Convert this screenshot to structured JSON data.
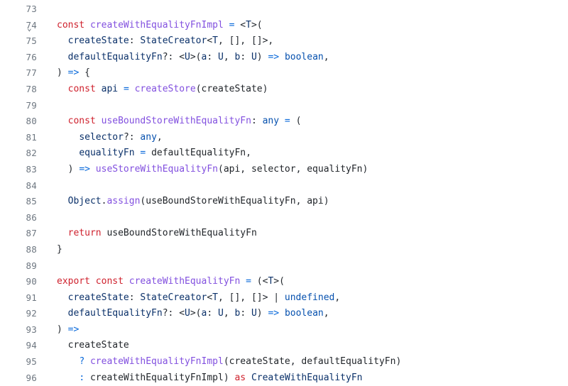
{
  "editor": {
    "lines": [
      {
        "num": "73",
        "fold": "",
        "tokens": []
      },
      {
        "num": "74",
        "fold": "v",
        "tokens": [
          {
            "c": "kw",
            "t": "const"
          },
          {
            "c": "plain",
            "t": " "
          },
          {
            "c": "def",
            "t": "createWithEqualityFnImpl"
          },
          {
            "c": "plain",
            "t": " "
          },
          {
            "c": "op",
            "t": "="
          },
          {
            "c": "plain",
            "t": " "
          },
          {
            "c": "punct",
            "t": "<"
          },
          {
            "c": "type",
            "t": "T"
          },
          {
            "c": "punct",
            "t": ">("
          }
        ]
      },
      {
        "num": "75",
        "fold": "",
        "tokens": [
          {
            "c": "plain",
            "t": "  "
          },
          {
            "c": "param",
            "t": "createState"
          },
          {
            "c": "punct",
            "t": ": "
          },
          {
            "c": "type",
            "t": "StateCreator"
          },
          {
            "c": "punct",
            "t": "<"
          },
          {
            "c": "type",
            "t": "T"
          },
          {
            "c": "punct",
            "t": ", [], []>,"
          }
        ]
      },
      {
        "num": "76",
        "fold": "",
        "tokens": [
          {
            "c": "plain",
            "t": "  "
          },
          {
            "c": "param",
            "t": "defaultEqualityFn"
          },
          {
            "c": "punct",
            "t": "?: <"
          },
          {
            "c": "type",
            "t": "U"
          },
          {
            "c": "punct",
            "t": ">("
          },
          {
            "c": "param",
            "t": "a"
          },
          {
            "c": "punct",
            "t": ": "
          },
          {
            "c": "type",
            "t": "U"
          },
          {
            "c": "punct",
            "t": ", "
          },
          {
            "c": "param",
            "t": "b"
          },
          {
            "c": "punct",
            "t": ": "
          },
          {
            "c": "type",
            "t": "U"
          },
          {
            "c": "punct",
            "t": ") "
          },
          {
            "c": "op",
            "t": "=>"
          },
          {
            "c": "plain",
            "t": " "
          },
          {
            "c": "builtin",
            "t": "boolean"
          },
          {
            "c": "punct",
            "t": ","
          }
        ]
      },
      {
        "num": "77",
        "fold": "",
        "tokens": [
          {
            "c": "punct",
            "t": ") "
          },
          {
            "c": "op",
            "t": "=>"
          },
          {
            "c": "plain",
            "t": " "
          },
          {
            "c": "punct",
            "t": "{"
          }
        ]
      },
      {
        "num": "78",
        "fold": "",
        "tokens": [
          {
            "c": "plain",
            "t": "  "
          },
          {
            "c": "kw",
            "t": "const"
          },
          {
            "c": "plain",
            "t": " "
          },
          {
            "c": "param",
            "t": "api"
          },
          {
            "c": "plain",
            "t": " "
          },
          {
            "c": "op",
            "t": "="
          },
          {
            "c": "plain",
            "t": " "
          },
          {
            "c": "fn",
            "t": "createStore"
          },
          {
            "c": "punct",
            "t": "("
          },
          {
            "c": "plain",
            "t": "createState"
          },
          {
            "c": "punct",
            "t": ")"
          }
        ]
      },
      {
        "num": "79",
        "fold": "",
        "tokens": []
      },
      {
        "num": "80",
        "fold": "",
        "tokens": [
          {
            "c": "plain",
            "t": "  "
          },
          {
            "c": "kw",
            "t": "const"
          },
          {
            "c": "plain",
            "t": " "
          },
          {
            "c": "def",
            "t": "useBoundStoreWithEqualityFn"
          },
          {
            "c": "punct",
            "t": ": "
          },
          {
            "c": "builtin",
            "t": "any"
          },
          {
            "c": "plain",
            "t": " "
          },
          {
            "c": "op",
            "t": "="
          },
          {
            "c": "plain",
            "t": " "
          },
          {
            "c": "punct",
            "t": "("
          }
        ]
      },
      {
        "num": "81",
        "fold": "",
        "tokens": [
          {
            "c": "plain",
            "t": "    "
          },
          {
            "c": "param",
            "t": "selector"
          },
          {
            "c": "punct",
            "t": "?: "
          },
          {
            "c": "builtin",
            "t": "any"
          },
          {
            "c": "punct",
            "t": ","
          }
        ]
      },
      {
        "num": "82",
        "fold": "",
        "tokens": [
          {
            "c": "plain",
            "t": "    "
          },
          {
            "c": "param",
            "t": "equalityFn"
          },
          {
            "c": "plain",
            "t": " "
          },
          {
            "c": "op",
            "t": "="
          },
          {
            "c": "plain",
            "t": " defaultEqualityFn"
          },
          {
            "c": "punct",
            "t": ","
          }
        ]
      },
      {
        "num": "83",
        "fold": "",
        "tokens": [
          {
            "c": "plain",
            "t": "  "
          },
          {
            "c": "punct",
            "t": ") "
          },
          {
            "c": "op",
            "t": "=>"
          },
          {
            "c": "plain",
            "t": " "
          },
          {
            "c": "fn",
            "t": "useStoreWithEqualityFn"
          },
          {
            "c": "punct",
            "t": "("
          },
          {
            "c": "plain",
            "t": "api"
          },
          {
            "c": "punct",
            "t": ", "
          },
          {
            "c": "plain",
            "t": "selector"
          },
          {
            "c": "punct",
            "t": ", "
          },
          {
            "c": "plain",
            "t": "equalityFn"
          },
          {
            "c": "punct",
            "t": ")"
          }
        ]
      },
      {
        "num": "84",
        "fold": "",
        "tokens": []
      },
      {
        "num": "85",
        "fold": "",
        "tokens": [
          {
            "c": "plain",
            "t": "  "
          },
          {
            "c": "type",
            "t": "Object"
          },
          {
            "c": "punct",
            "t": "."
          },
          {
            "c": "fn",
            "t": "assign"
          },
          {
            "c": "punct",
            "t": "("
          },
          {
            "c": "plain",
            "t": "useBoundStoreWithEqualityFn"
          },
          {
            "c": "punct",
            "t": ", "
          },
          {
            "c": "plain",
            "t": "api"
          },
          {
            "c": "punct",
            "t": ")"
          }
        ]
      },
      {
        "num": "86",
        "fold": "",
        "tokens": []
      },
      {
        "num": "87",
        "fold": "",
        "tokens": [
          {
            "c": "plain",
            "t": "  "
          },
          {
            "c": "kw",
            "t": "return"
          },
          {
            "c": "plain",
            "t": " useBoundStoreWithEqualityFn"
          }
        ]
      },
      {
        "num": "88",
        "fold": "",
        "tokens": [
          {
            "c": "punct",
            "t": "}"
          }
        ]
      },
      {
        "num": "89",
        "fold": "",
        "tokens": []
      },
      {
        "num": "90",
        "fold": "",
        "tokens": [
          {
            "c": "kw",
            "t": "export"
          },
          {
            "c": "plain",
            "t": " "
          },
          {
            "c": "kw",
            "t": "const"
          },
          {
            "c": "plain",
            "t": " "
          },
          {
            "c": "def",
            "t": "createWithEqualityFn"
          },
          {
            "c": "plain",
            "t": " "
          },
          {
            "c": "op",
            "t": "="
          },
          {
            "c": "plain",
            "t": " "
          },
          {
            "c": "punct",
            "t": "(<"
          },
          {
            "c": "type",
            "t": "T"
          },
          {
            "c": "punct",
            "t": ">("
          }
        ]
      },
      {
        "num": "91",
        "fold": "",
        "tokens": [
          {
            "c": "plain",
            "t": "  "
          },
          {
            "c": "param",
            "t": "createState"
          },
          {
            "c": "punct",
            "t": ": "
          },
          {
            "c": "type",
            "t": "StateCreator"
          },
          {
            "c": "punct",
            "t": "<"
          },
          {
            "c": "type",
            "t": "T"
          },
          {
            "c": "punct",
            "t": ", [], []> | "
          },
          {
            "c": "builtin",
            "t": "undefined"
          },
          {
            "c": "punct",
            "t": ","
          }
        ]
      },
      {
        "num": "92",
        "fold": "",
        "tokens": [
          {
            "c": "plain",
            "t": "  "
          },
          {
            "c": "param",
            "t": "defaultEqualityFn"
          },
          {
            "c": "punct",
            "t": "?: <"
          },
          {
            "c": "type",
            "t": "U"
          },
          {
            "c": "punct",
            "t": ">("
          },
          {
            "c": "param",
            "t": "a"
          },
          {
            "c": "punct",
            "t": ": "
          },
          {
            "c": "type",
            "t": "U"
          },
          {
            "c": "punct",
            "t": ", "
          },
          {
            "c": "param",
            "t": "b"
          },
          {
            "c": "punct",
            "t": ": "
          },
          {
            "c": "type",
            "t": "U"
          },
          {
            "c": "punct",
            "t": ") "
          },
          {
            "c": "op",
            "t": "=>"
          },
          {
            "c": "plain",
            "t": " "
          },
          {
            "c": "builtin",
            "t": "boolean"
          },
          {
            "c": "punct",
            "t": ","
          }
        ]
      },
      {
        "num": "93",
        "fold": "",
        "tokens": [
          {
            "c": "punct",
            "t": ") "
          },
          {
            "c": "op",
            "t": "=>"
          }
        ]
      },
      {
        "num": "94",
        "fold": "",
        "tokens": [
          {
            "c": "plain",
            "t": "  createState"
          }
        ]
      },
      {
        "num": "95",
        "fold": "",
        "tokens": [
          {
            "c": "plain",
            "t": "    "
          },
          {
            "c": "op",
            "t": "?"
          },
          {
            "c": "plain",
            "t": " "
          },
          {
            "c": "fn",
            "t": "createWithEqualityFnImpl"
          },
          {
            "c": "punct",
            "t": "("
          },
          {
            "c": "plain",
            "t": "createState"
          },
          {
            "c": "punct",
            "t": ", "
          },
          {
            "c": "plain",
            "t": "defaultEqualityFn"
          },
          {
            "c": "punct",
            "t": ")"
          }
        ]
      },
      {
        "num": "96",
        "fold": "",
        "tokens": [
          {
            "c": "plain",
            "t": "    "
          },
          {
            "c": "op",
            "t": ":"
          },
          {
            "c": "plain",
            "t": " createWithEqualityFnImpl"
          },
          {
            "c": "punct",
            "t": ") "
          },
          {
            "c": "kw",
            "t": "as"
          },
          {
            "c": "plain",
            "t": " "
          },
          {
            "c": "type",
            "t": "CreateWithEqualityFn"
          }
        ]
      }
    ]
  }
}
